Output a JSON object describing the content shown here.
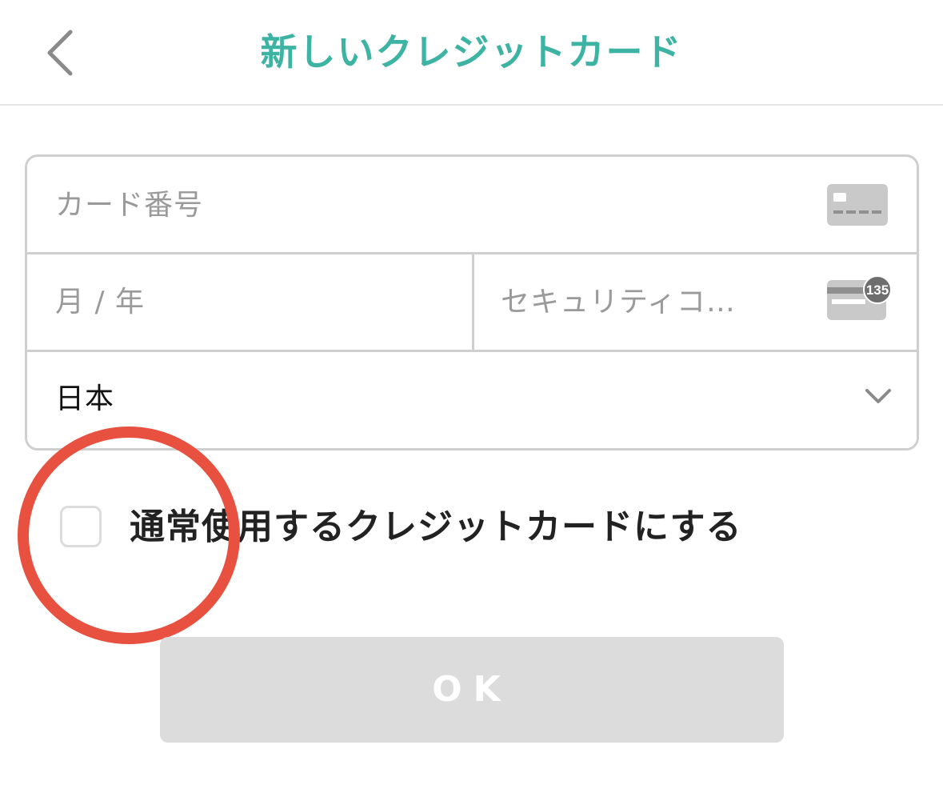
{
  "header": {
    "title": "新しいクレジットカード",
    "back_icon": "chevron-left-icon"
  },
  "form": {
    "card_number_placeholder": "カード番号",
    "expiry_placeholder": "月 / 年",
    "cvc_placeholder": "セキュリティコ…",
    "cvc_icon_badge": "135",
    "country_value": "日本"
  },
  "default_card": {
    "label": "通常使用するクレジットカードにする",
    "checked": false
  },
  "ok_button": {
    "label": "OK"
  },
  "colors": {
    "accent": "#3db3a4",
    "border": "#cfcfcf",
    "placeholder": "#9a9a9a",
    "button_disabled": "#dcdcdc",
    "annotation": "#e8503f"
  }
}
